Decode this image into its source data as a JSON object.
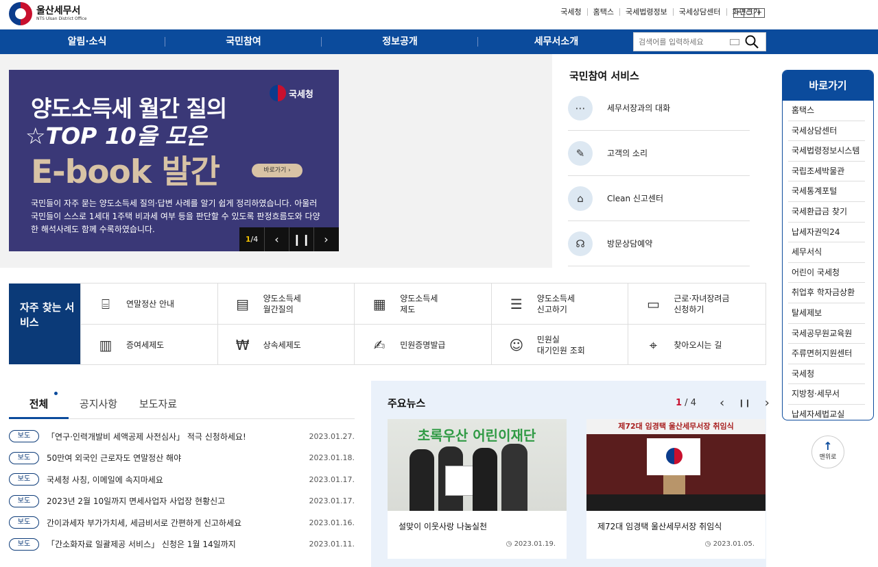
{
  "header": {
    "logo_title": "울산세무서",
    "logo_sub": "NTS Ulsan District Office",
    "util_links": [
      "국세청",
      "홈택스",
      "국세법령정보",
      "국세상담센터",
      "화면크기"
    ],
    "zoom": [
      "−",
      "○",
      "+"
    ]
  },
  "nav": {
    "items": [
      "알림·소식",
      "국민참여",
      "정보공개",
      "세무서소개"
    ],
    "search_placeholder": "검색어를 입력하세요"
  },
  "banner": {
    "brand": "국세청",
    "line1": "양도소득세 월간 질의",
    "line2": "☆TOP 10을 모은",
    "line3": "E-book 발간",
    "button": "바로가기 ›",
    "desc": "국민들이 자주 묻는 양도소득세 질의·답변 사례를 알기 쉽게 정리하였습니다. 아울러 국민들이 스스로 1세대 1주택 비과세 여부 등을 판단할 수 있도록 판정흐름도와 다양한 해석사례도 함께 수록하였습니다.",
    "page_current": "1",
    "page_total": "4",
    "prev": "‹",
    "pause": "❙❙",
    "next": "›"
  },
  "services": {
    "title": "국민참여 서비스",
    "items": [
      {
        "label": "세무서장과의 대화",
        "icon": "chat-icon"
      },
      {
        "label": "고객의 소리",
        "icon": "pen-icon"
      },
      {
        "label": "Clean 신고센터",
        "icon": "siren-icon"
      },
      {
        "label": "방문상담예약",
        "icon": "headset-icon"
      }
    ]
  },
  "quick": {
    "title": "바로가기",
    "items": [
      "홈택스",
      "국세상담센터",
      "국세법령정보시스템",
      "국립조세박물관",
      "국세통계포털",
      "국세환급금 찾기",
      "납세자권익24",
      "세무서식",
      "어린이 국세청",
      "취업후 학자금상환",
      "탈세제보",
      "국세공무원교육원",
      "주류면허지원센터",
      "국세청",
      "지방청·세무서",
      "납세자세법교실"
    ],
    "top_label": "맨위로"
  },
  "frequent": {
    "title": "자주 찾는 서비스",
    "items": [
      {
        "label": "연말정산 안내",
        "icon": "bookmark-icon"
      },
      {
        "label": "양도소득세\n월간질의",
        "icon": "card-hand-icon"
      },
      {
        "label": "양도소득세\n제도",
        "icon": "calculator-icon"
      },
      {
        "label": "양도소득세\n신고하기",
        "icon": "document-list-icon"
      },
      {
        "label": "근로·자녀장려금\n신청하기",
        "icon": "document-icon"
      },
      {
        "label": "증여세제도",
        "icon": "documents-icon"
      },
      {
        "label": "상속세제도",
        "icon": "coin-hand-icon"
      },
      {
        "label": "민원증명발급",
        "icon": "certificate-icon"
      },
      {
        "label": "민원실\n대기인원 조회",
        "icon": "people-icon"
      },
      {
        "label": "찾아오시는 길",
        "icon": "map-pin-icon"
      }
    ]
  },
  "news": {
    "tabs": [
      "전체",
      "공지사항",
      "보도자료"
    ],
    "rows": [
      {
        "badge": "보도",
        "title": "「연구·인력개발비 세액공제 사전심사」 적극 신청하세요!",
        "date": "2023.01.27."
      },
      {
        "badge": "보도",
        "title": "50만여 외국인 근로자도 연말정산 해야",
        "date": "2023.01.18."
      },
      {
        "badge": "보도",
        "title": "국세청 사칭, 이메일에 속지마세요",
        "date": "2023.01.17."
      },
      {
        "badge": "보도",
        "title": "2023년 2월 10일까지 면세사업자 사업장 현황신고",
        "date": "2023.01.17."
      },
      {
        "badge": "보도",
        "title": "간이과세자 부가가치세, 세금비서로 간편하게 신고하세요",
        "date": "2023.01.16."
      },
      {
        "badge": "보도",
        "title": "「간소화자료 일괄제공 서비스」 신청은 1월 14일까지",
        "date": "2023.01.11."
      }
    ]
  },
  "main_news": {
    "title": "주요뉴스",
    "page_current": "1",
    "page_total": "4",
    "prev": "‹",
    "pause": "❙❙",
    "next": "›",
    "cards": [
      {
        "caption": "설맞이 이웃사랑 나눔실천",
        "date": "2023.01.19.",
        "img_text": "초록우산 어린이재단"
      },
      {
        "caption": "제72대 임경택 울산세무서장 취임식",
        "date": "2023.01.05.",
        "img_text": "제72대 임경택 울산세무서장 취임식"
      }
    ]
  },
  "colors": {
    "primary": "#0b4b9c",
    "dark": "#0b3a78",
    "banner": "#3a3877",
    "accent": "#c8102e"
  }
}
